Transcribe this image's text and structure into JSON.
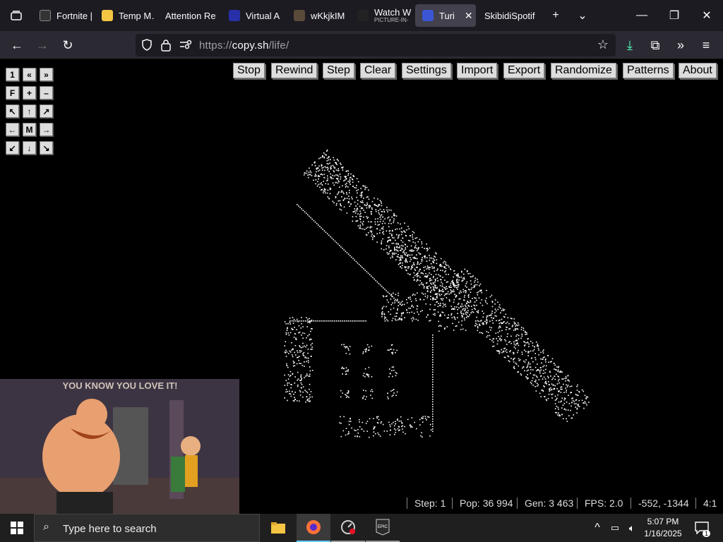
{
  "tabs": [
    {
      "label": "Fortnite |"
    },
    {
      "label": "Temp M…"
    },
    {
      "label": "Attention Re"
    },
    {
      "label": "Virtual A"
    },
    {
      "label": "wKkjkIM"
    },
    {
      "label": "Watch W",
      "sub": "PICTURE-IN-"
    },
    {
      "label": "Turi"
    },
    {
      "label": "SkibidiSpotif"
    }
  ],
  "url": {
    "scheme": "https://",
    "host": "copy.sh",
    "path": "/life/"
  },
  "toolbar": [
    "Stop",
    "Rewind",
    "Step",
    "Clear",
    "Settings",
    "Import",
    "Export",
    "Randomize",
    "Patterns",
    "About"
  ],
  "controls": [
    [
      "1",
      "«",
      "»"
    ],
    [
      "F",
      "+",
      "–"
    ],
    [
      "↖",
      "↑",
      "↗"
    ],
    [
      "←",
      "M",
      "→"
    ],
    [
      "↙",
      "↓",
      "↘"
    ]
  ],
  "status": {
    "step": "Step: 1",
    "pop": "Pop: 36 994",
    "gen": "Gen: 3 463",
    "fps": "FPS: 2.0",
    "coords": "-552, -1344",
    "zoom": "4:1"
  },
  "pip": {
    "caption": "YOU KNOW YOU LOVE IT!"
  },
  "taskbar": {
    "search_placeholder": "Type here to search",
    "time": "5:07 PM",
    "date": "1/16/2025",
    "notif_count": "1"
  }
}
